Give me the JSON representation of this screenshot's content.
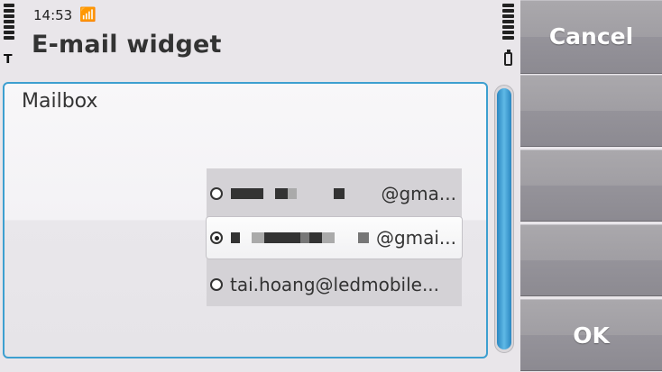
{
  "status_bar": {
    "time": "14:53",
    "connection_icon": "gprs-icon",
    "signal_icon": "signal-strength-icon",
    "battery_icon": "battery-icon"
  },
  "header": {
    "title": "E-mail widget"
  },
  "panel": {
    "label": "Mailbox",
    "accent_color": "#3d9fd0"
  },
  "mailbox_options": [
    {
      "label": "@gma...",
      "selected": false
    },
    {
      "label": "@gmai...",
      "selected": true
    },
    {
      "label": "tai.hoang@ledmobile...",
      "selected": false
    }
  ],
  "softkeys": {
    "cancel": "Cancel",
    "ok": "OK"
  }
}
